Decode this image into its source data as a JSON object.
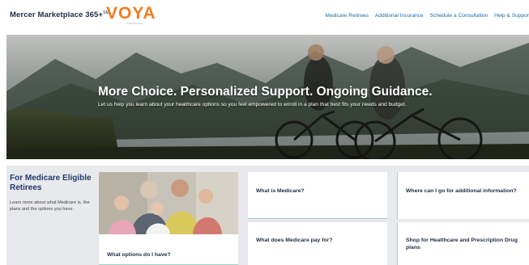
{
  "header": {
    "brand": "Mercer Marketplace 365+",
    "brand_mark": "SM",
    "logo_text": "VOYA",
    "logo_subtext": "FINANCIAL",
    "nav": [
      {
        "label": "Medicare Retirees"
      },
      {
        "label": "Additional Insurance"
      },
      {
        "label": "Schedule a Consultation"
      },
      {
        "label": "Help & Suppor"
      }
    ]
  },
  "hero": {
    "title": "More Choice. Personalized Support. Ongoing Guidance.",
    "subtitle": "Let us help you learn about your healthcare options so you feel empowered to enroll in a plan that best fits your needs and budget."
  },
  "section": {
    "title": "For Medicare Eligible Retirees",
    "description": "Learn more about what Medicare is, the plans and the options you have."
  },
  "cards": {
    "options": "What options do I have?",
    "what_is": "What is Medicare?",
    "where": "Where can I go for additional information?",
    "pays": "What does Medicare pay for?",
    "shop": "Shop for Healthcare and Prescription Drug plans"
  },
  "colors": {
    "brand_navy": "#1f2a44",
    "voya_orange": "#f47b20",
    "link_blue": "#1a6aa8",
    "accent_teal": "#9dd3cc",
    "section_gray": "#e8e9ec"
  }
}
